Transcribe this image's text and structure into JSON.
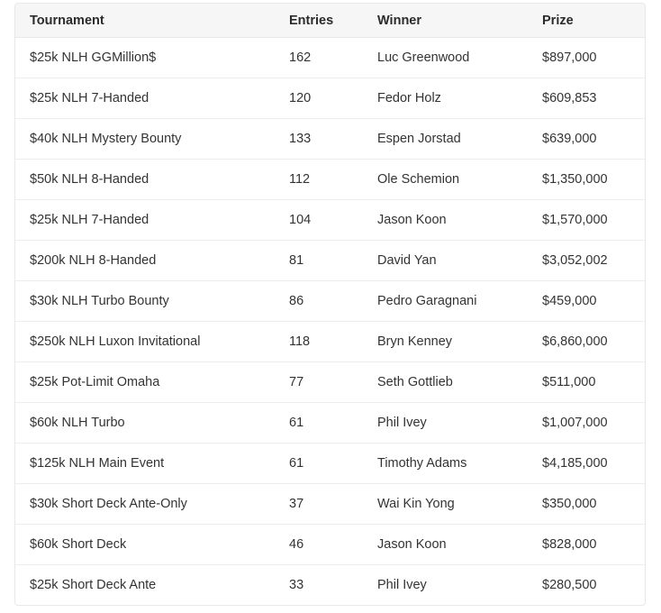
{
  "table": {
    "name": "tournament-results",
    "columns": [
      {
        "key": "tournament",
        "label": "Tournament"
      },
      {
        "key": "entries",
        "label": "Entries"
      },
      {
        "key": "winner",
        "label": "Winner"
      },
      {
        "key": "prize",
        "label": "Prize"
      }
    ],
    "rows": [
      {
        "tournament": "$25k NLH GGMillion$",
        "entries": "162",
        "winner": "Luc Greenwood",
        "prize": "$897,000"
      },
      {
        "tournament": "$25k NLH 7-Handed",
        "entries": "120",
        "winner": "Fedor Holz",
        "prize": "$609,853"
      },
      {
        "tournament": "$40k NLH Mystery Bounty",
        "entries": "133",
        "winner": "Espen Jorstad",
        "prize": "$639,000"
      },
      {
        "tournament": "$50k NLH 8-Handed",
        "entries": "112",
        "winner": "Ole Schemion",
        "prize": "$1,350,000"
      },
      {
        "tournament": "$25k NLH 7-Handed",
        "entries": "104",
        "winner": "Jason Koon",
        "prize": "$1,570,000"
      },
      {
        "tournament": "$200k NLH 8-Handed",
        "entries": "81",
        "winner": "David Yan",
        "prize": "$3,052,002"
      },
      {
        "tournament": "$30k NLH Turbo Bounty",
        "entries": "86",
        "winner": "Pedro Garagnani",
        "prize": "$459,000"
      },
      {
        "tournament": "$250k NLH Luxon Invitational",
        "entries": "118",
        "winner": "Bryn Kenney",
        "prize": "$6,860,000"
      },
      {
        "tournament": "$25k Pot-Limit Omaha",
        "entries": "77",
        "winner": "Seth Gottlieb",
        "prize": "$511,000"
      },
      {
        "tournament": "$60k NLH Turbo",
        "entries": "61",
        "winner": "Phil Ivey",
        "prize": "$1,007,000"
      },
      {
        "tournament": "$125k NLH Main Event",
        "entries": "61",
        "winner": "Timothy Adams",
        "prize": "$4,185,000"
      },
      {
        "tournament": "$30k Short Deck Ante-Only",
        "entries": "37",
        "winner": "Wai Kin Yong",
        "prize": "$350,000"
      },
      {
        "tournament": "$60k Short Deck",
        "entries": "46",
        "winner": "Jason Koon",
        "prize": "$828,000"
      },
      {
        "tournament": "$25k Short Deck Ante",
        "entries": "33",
        "winner": "Phil Ivey",
        "prize": "$280,500"
      }
    ]
  },
  "colors": {
    "page_background": "#ffffff",
    "header_background": "#f6f6f6",
    "row_background": "#ffffff",
    "border": "#e8e8e8",
    "row_divider": "#ededed",
    "header_text": "#2b2b2b",
    "body_text": "#333333"
  }
}
